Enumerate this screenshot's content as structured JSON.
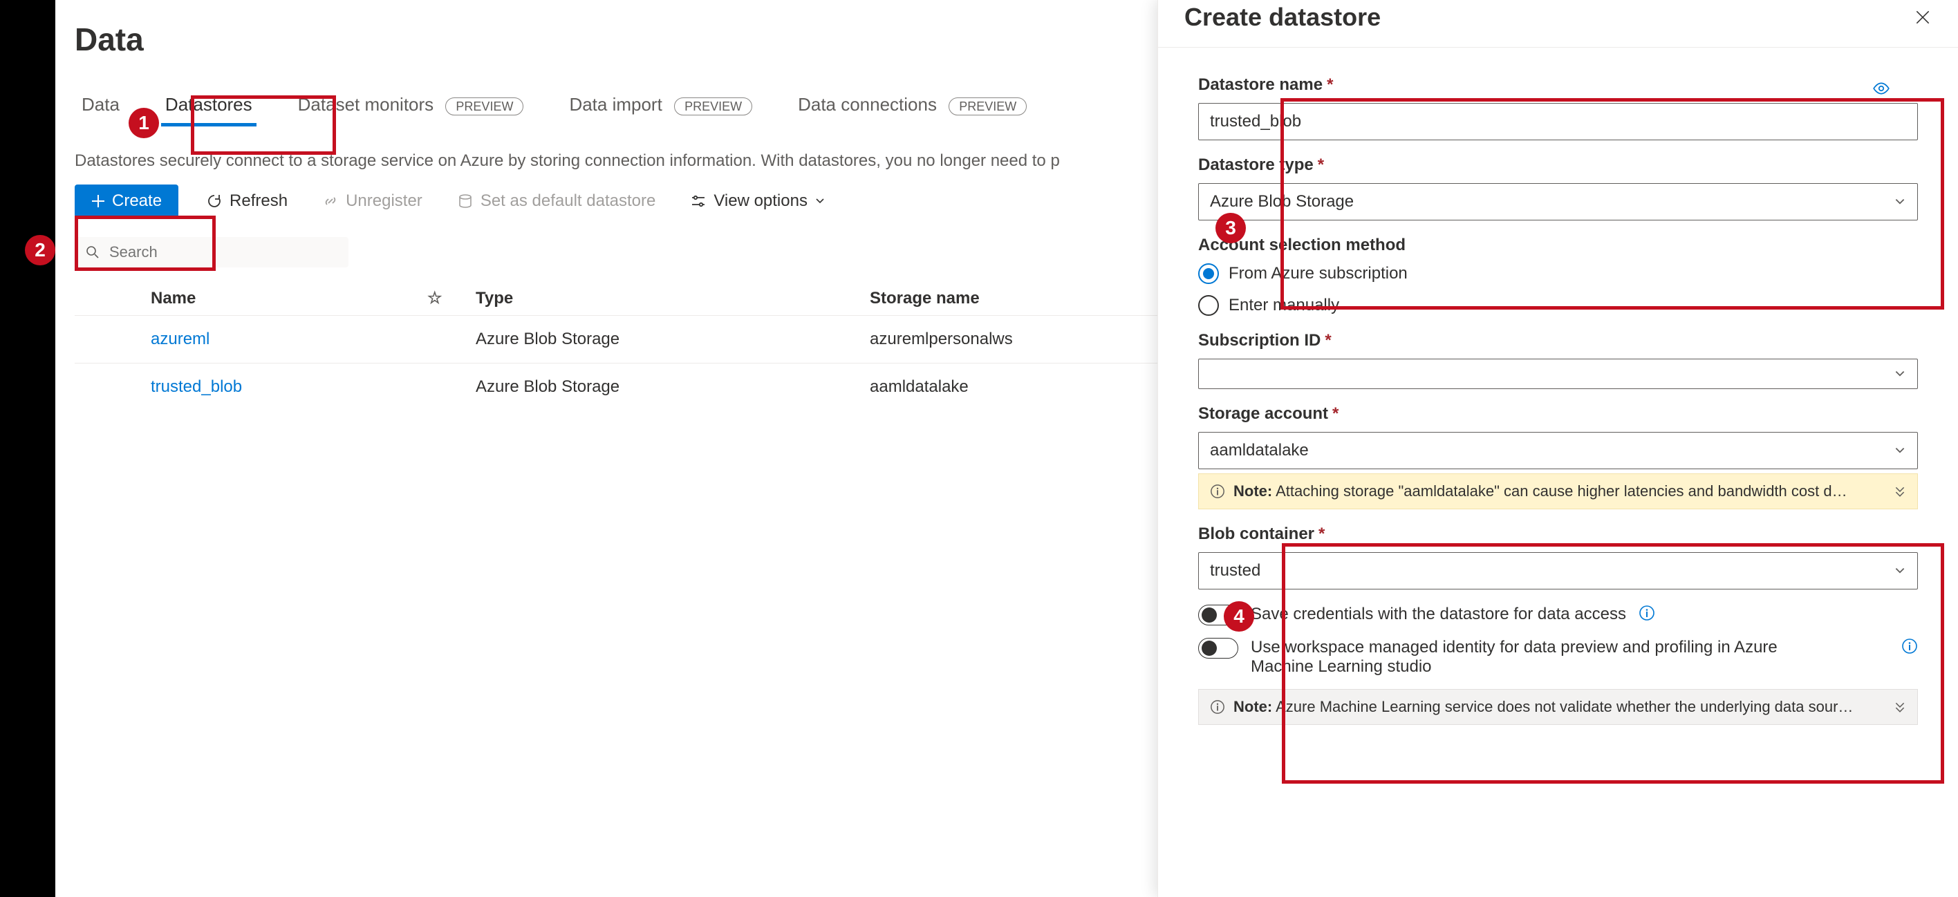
{
  "page": {
    "title": "Data",
    "description": "Datastores securely connect to a storage service on Azure by storing connection information. With datastores, you no longer need to p"
  },
  "tabs": {
    "data_assets": "Data",
    "data_assets_suffix_hint": "s",
    "datastores": "Datastores",
    "dataset_monitors": "Dataset monitors",
    "data_import": "Data import",
    "data_connections": "Data connections",
    "preview_badge": "PREVIEW"
  },
  "toolbar": {
    "create": "Create",
    "refresh": "Refresh",
    "unregister": "Unregister",
    "set_default": "Set as default datastore",
    "view_options": "View options"
  },
  "search": {
    "placeholder": "Search"
  },
  "table": {
    "headers": {
      "name": "Name",
      "type": "Type",
      "storage": "Storage name"
    },
    "rows": [
      {
        "name": "azureml",
        "type": "Azure Blob Storage",
        "storage": "azuremlpersonalws"
      },
      {
        "name": "trusted_blob",
        "type": "Azure Blob Storage",
        "storage": "aamldatalake"
      }
    ]
  },
  "panel": {
    "title": "Create datastore",
    "labels": {
      "datastore_name": "Datastore name",
      "datastore_type": "Datastore type",
      "account_selection": "Account selection method",
      "from_sub": "From Azure subscription",
      "enter_manually": "Enter manually",
      "subscription_id": "Subscription ID",
      "storage_account": "Storage account",
      "blob_container": "Blob container",
      "save_credentials": "Save credentials with the datastore for data access",
      "use_managed_identity": "Use workspace managed identity for data preview and profiling in Azure Machine Learning studio"
    },
    "values": {
      "datastore_name": "trusted_blob",
      "datastore_type": "Azure Blob Storage",
      "subscription_id": "",
      "storage_account": "aamldatalake",
      "blob_container": "trusted"
    },
    "notes": {
      "label": "Note:",
      "storage_warning": "Attaching storage \"aamldatalake\" can cause higher latencies and bandwidth cost d…",
      "validate_warning": "Azure Machine Learning service does not validate whether the underlying data sour…"
    }
  },
  "callouts": {
    "c1": "1",
    "c2": "2",
    "c3": "3",
    "c4": "4"
  }
}
